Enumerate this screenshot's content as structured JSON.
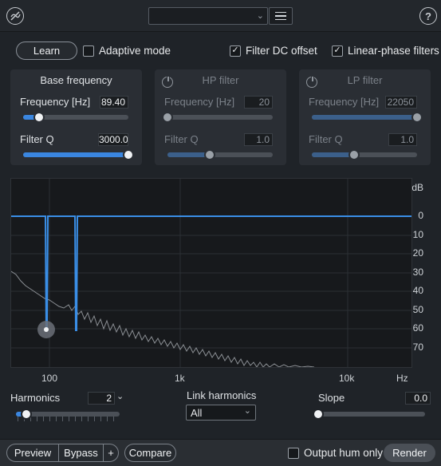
{
  "header": {
    "preset_value": "",
    "icons": {
      "logo": "rx-logo-icon",
      "menu": "hamburger-menu-icon",
      "help": "help-icon"
    },
    "help_label": "?"
  },
  "controls": {
    "learn_label": "Learn",
    "adaptive_mode": {
      "label": "Adaptive mode",
      "checked": false
    },
    "filter_dc_offset": {
      "label": "Filter DC offset",
      "checked": true
    },
    "linear_phase": {
      "label": "Linear-phase filters",
      "checked": true
    }
  },
  "base_frequency": {
    "title": "Base frequency",
    "frequency_label": "Frequency [Hz]",
    "frequency_value": "89.40",
    "filter_q_label": "Filter Q",
    "filter_q_value": "3000.0",
    "frequency_level": 0.15,
    "filter_q_level": 1.0
  },
  "hp_filter": {
    "title": "HP filter",
    "enabled": false,
    "frequency_label": "Frequency [Hz]",
    "frequency_value": "20",
    "filter_q_label": "Filter Q",
    "filter_q_value": "1.0",
    "frequency_level": 0.0,
    "filter_q_level": 0.4
  },
  "lp_filter": {
    "title": "LP filter",
    "enabled": false,
    "frequency_label": "Frequency [Hz]",
    "frequency_value": "22050",
    "filter_q_label": "Filter Q",
    "filter_q_value": "1.0",
    "frequency_level": 1.0,
    "filter_q_level": 0.4
  },
  "graph": {
    "db_unit": "dB",
    "db_ticks": [
      "0",
      "10",
      "20",
      "30",
      "40",
      "50",
      "60",
      "70"
    ],
    "freq_ticks": [
      "100",
      "1k",
      "10k"
    ],
    "freq_unit": "Hz",
    "colors": {
      "curve": "#3a8ee6",
      "spectrum": "#8b8f94",
      "handle": "#6b7078"
    }
  },
  "harmonics": {
    "label": "Harmonics",
    "value": "2",
    "level": 0.1
  },
  "link_harmonics": {
    "label": "Link harmonics",
    "selected": "All"
  },
  "slope": {
    "label": "Slope",
    "value": "0.0",
    "level": 0.0
  },
  "footer": {
    "preview_label": "Preview",
    "bypass_label": "Bypass",
    "plus_label": "+",
    "compare_label": "Compare",
    "output_hum_only": {
      "label": "Output hum only",
      "checked": false
    },
    "render_label": "Render"
  }
}
